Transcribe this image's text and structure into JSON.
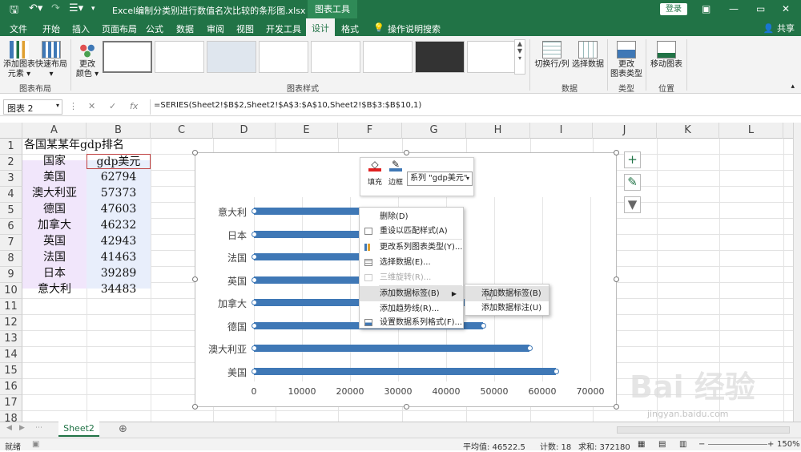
{
  "titlebar": {
    "document_title": "Excel编制分类别进行数值名次比较的条形图.xlsx - Excel",
    "context_tab": "图表工具",
    "login": "登录",
    "restore_glyph": "▭"
  },
  "tabs": [
    "文件",
    "开始",
    "插入",
    "页面布局",
    "公式",
    "数据",
    "审阅",
    "视图",
    "开发工具",
    "设计",
    "格式",
    "操作说明搜索"
  ],
  "share": "共享",
  "ribbon": {
    "add_element": "添加图表\n元素 ▾",
    "quick_layout": "快速布局\n▾",
    "change_colors": "更改\n颜色 ▾",
    "switch_row_col": "切换行/列",
    "select_data": "选择数据",
    "change_type": "更改\n图表类型",
    "move_chart": "移动图表",
    "groups": {
      "layouts": "图表布局",
      "styles": "图表样式",
      "data": "数据",
      "type": "类型",
      "location": "位置"
    }
  },
  "formula": {
    "name_box": "图表 2",
    "fx": "fx",
    "cancel": "✕",
    "enter": "✓",
    "value": "=SERIES(Sheet2!$B$2,Sheet2!$A$3:$A$10,Sheet2!$B$3:$B$10,1)"
  },
  "columns": [
    "A",
    "B",
    "C",
    "D",
    "E",
    "F",
    "G",
    "H",
    "I",
    "J",
    "K",
    "L"
  ],
  "rows": [
    "1",
    "2",
    "3",
    "4",
    "5",
    "6",
    "7",
    "8",
    "9",
    "10",
    "11",
    "12",
    "13",
    "14",
    "15",
    "16",
    "17",
    "18"
  ],
  "cells": {
    "title": "各国某某年gdp排名",
    "header_country": "国家",
    "header_gdp": "gdp美元",
    "countries": [
      "美国",
      "澳大利亚",
      "德国",
      "加拿大",
      "英国",
      "法国",
      "日本",
      "意大利"
    ],
    "gdp": [
      "62794",
      "57373",
      "47603",
      "46232",
      "42943",
      "41463",
      "39289",
      "34483"
    ]
  },
  "chart_data": {
    "type": "bar",
    "categories": [
      "美国",
      "澳大利亚",
      "德国",
      "加拿大",
      "英国",
      "法国",
      "日本",
      "意大利"
    ],
    "series": [
      {
        "name": "gdp美元",
        "values": [
          62794,
          57373,
          47603,
          46232,
          42943,
          41463,
          39289,
          34483
        ]
      }
    ],
    "xlim": [
      0,
      70000
    ],
    "xticks": [
      "0",
      "10000",
      "20000",
      "30000",
      "40000",
      "50000",
      "60000",
      "70000"
    ],
    "grid": true,
    "bar_color": "#3f78b6"
  },
  "mini_toolbar": {
    "fill": "填充",
    "outline": "边框",
    "series": "系列 \"gdp美元\""
  },
  "context_menu": [
    "删除(D)",
    "重设以匹配样式(A)",
    "更改系列图表类型(Y)...",
    "选择数据(E)...",
    "三维旋转(R)...",
    "添加数据标签(B)",
    "添加趋势线(R)...",
    "设置数据系列格式(F)..."
  ],
  "submenu": [
    "添加数据标签(B)",
    "添加数据标注(U)"
  ],
  "sheet_tab": "Sheet2",
  "status": {
    "mode": "就绪",
    "average": "平均值: 46522.5",
    "count": "计数: 18",
    "sum": "求和: 372180",
    "zoom": "150%"
  },
  "watermark": {
    "logo": "Bai 经验",
    "url": "jingyan.baidu.com"
  }
}
